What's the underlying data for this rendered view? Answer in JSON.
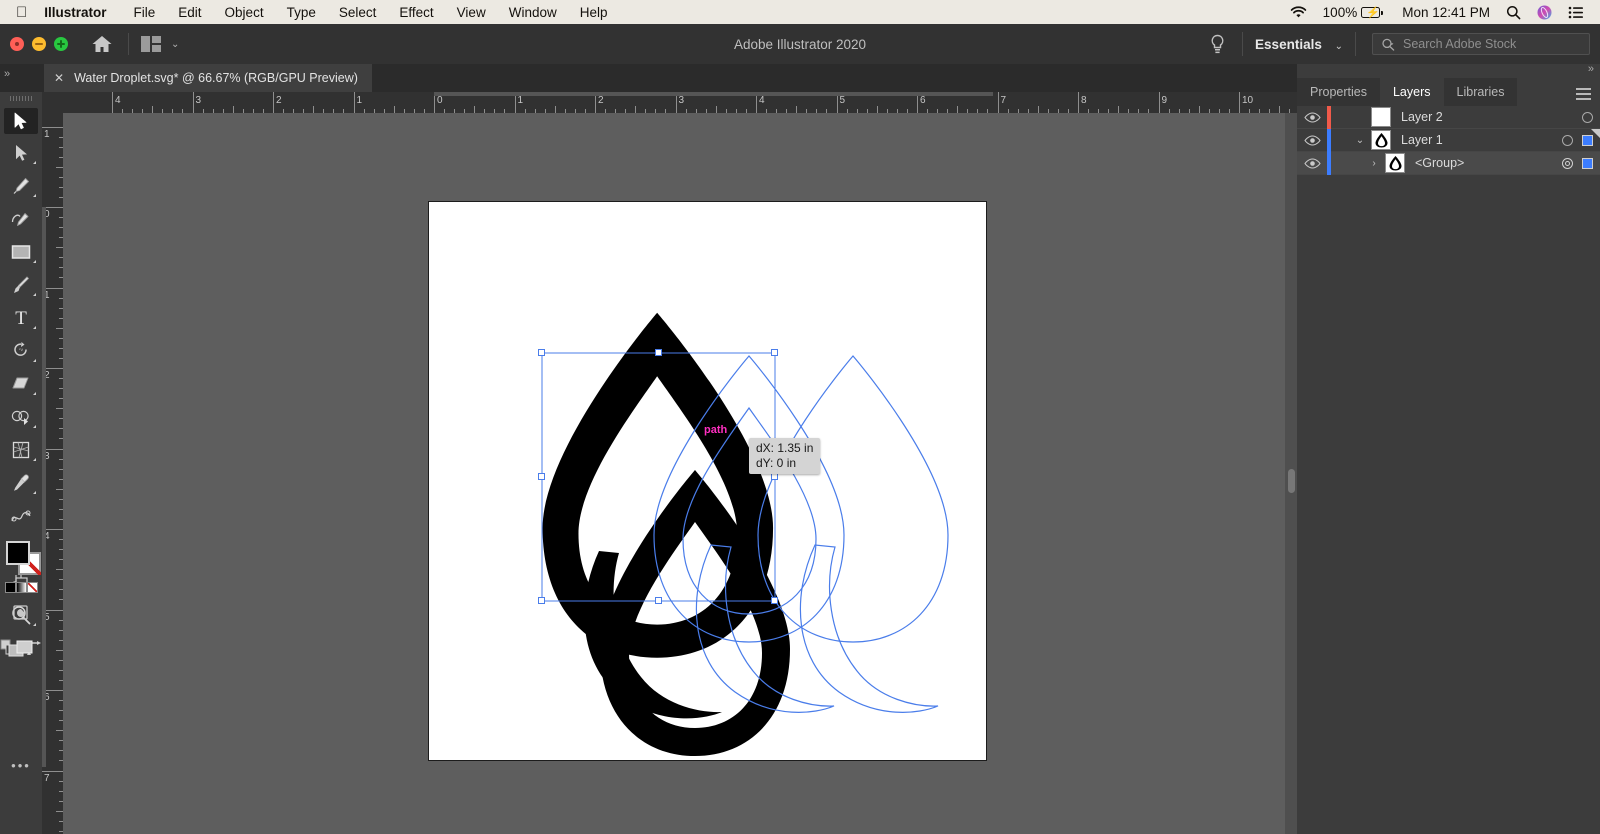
{
  "macmenu": {
    "apple_icon": "apple-logo-icon",
    "items": [
      "Illustrator",
      "File",
      "Edit",
      "Object",
      "Type",
      "Select",
      "Effect",
      "View",
      "Window",
      "Help"
    ],
    "status": {
      "wifi_icon": "wifi-icon",
      "battery_percent": "100%",
      "battery_icon": "battery-charging-icon",
      "clock": "Mon 12:41 PM",
      "spotlight_icon": "search-icon",
      "siri_icon": "siri-icon",
      "controlcenter_icon": "control-center-icon"
    }
  },
  "titlebar": {
    "app_title": "Adobe Illustrator 2020",
    "home_icon": "home-icon",
    "arrange_icon": "arrange-documents-icon",
    "arrange_chevron": "⌄",
    "bulb_icon": "lightbulb-icon",
    "workspace": "Essentials",
    "workspace_chevron": "⌄",
    "search_icon": "search-icon",
    "search_placeholder": "Search Adobe Stock",
    "search_value": ""
  },
  "tabbar": {
    "collapse_arrows": "»",
    "close_icon": "close-icon",
    "document_tab": "Water Droplet.svg* @ 66.67% (RGB/GPU Preview)"
  },
  "toolbar": {
    "grip_icon": "panel-grip-icon",
    "tools": [
      {
        "name": "selection-tool",
        "active": true,
        "flyout": false
      },
      {
        "name": "direct-selection-tool",
        "active": false,
        "flyout": true
      },
      {
        "name": "pen-tool",
        "active": false,
        "flyout": true
      },
      {
        "name": "curvature-tool",
        "active": false,
        "flyout": false
      },
      {
        "name": "rectangle-tool",
        "active": false,
        "flyout": true
      },
      {
        "name": "paintbrush-tool",
        "active": false,
        "flyout": true
      },
      {
        "name": "type-tool",
        "active": false,
        "flyout": true
      },
      {
        "name": "rotate-tool",
        "active": false,
        "flyout": true
      },
      {
        "name": "eraser-tool",
        "active": false,
        "flyout": true
      },
      {
        "name": "shape-builder-tool",
        "active": false,
        "flyout": true
      },
      {
        "name": "gradient-mesh-tool",
        "active": false,
        "flyout": true
      },
      {
        "name": "eyedropper-tool",
        "active": false,
        "flyout": true
      },
      {
        "name": "blend-tool",
        "active": false,
        "flyout": false
      },
      {
        "name": "symbol-sprayer-tool",
        "active": false,
        "flyout": true
      },
      {
        "name": "artboard-tool",
        "active": false,
        "flyout": false
      },
      {
        "name": "zoom-tool",
        "active": false,
        "flyout": true
      }
    ],
    "swap_fill_stroke_icon": "swap-fill-stroke-icon",
    "default_fill_stroke_icon": "default-fill-stroke-icon",
    "fill_color": "#000000",
    "stroke_color": "#ffffff",
    "stroke_none": true,
    "color_mini": "color-swatch-icon",
    "gradient_mini": "gradient-swatch-icon",
    "none_mini": "none-swatch-icon",
    "drawing_mode_icon": "draw-normal-icon",
    "screen_mode_icon": "change-screen-mode-icon",
    "more_tools": "•••"
  },
  "rulers": {
    "unit": "in",
    "h_labels": [
      "4",
      "3",
      "2",
      "1",
      "0",
      "1",
      "2",
      "3",
      "4",
      "5",
      "6",
      "7",
      "8",
      "9",
      "10"
    ],
    "v_labels": [
      "1",
      "0",
      "1",
      "2",
      "3",
      "4",
      "5",
      "6",
      "7"
    ]
  },
  "canvas": {
    "artboard_fill": "#ffffff",
    "canvas_fill": "#5e5e5e",
    "selection_color": "#4a7dea",
    "artwork_fill": "#000000",
    "smart_guide_label": "path",
    "smart_guide_color": "#ff2fc1",
    "tooltip": {
      "dx": "dX: 1.35 in",
      "dy": "dY: 0 in"
    },
    "scrollbar_icon": "vertical-scrollbar"
  },
  "rightpanel": {
    "collapse_arrows": "»",
    "expand_chevron": "⌃",
    "menu_icon": "panel-menu-icon",
    "tabs": [
      {
        "label": "Properties",
        "selected": false
      },
      {
        "label": "Layers",
        "selected": true
      },
      {
        "label": "Libraries",
        "selected": false
      }
    ],
    "layers": [
      {
        "name": "Layer 2",
        "visibility_icon": "eye-icon",
        "color": "#f05a4a",
        "thumb_icon": "blank-layer-thumbnail",
        "disclosure": "",
        "indent": 0,
        "selected": false,
        "target_icon": "target-circle-icon",
        "has_selection_square": false
      },
      {
        "name": "Layer 1",
        "visibility_icon": "eye-icon",
        "color": "#3c7dff",
        "thumb_icon": "droplet-layer-thumbnail",
        "disclosure": "⌄",
        "indent": 0,
        "selected": false,
        "target_icon": "target-circle-icon",
        "has_selection_square": true
      },
      {
        "name": "<Group>",
        "visibility_icon": "eye-icon",
        "color": "#3c7dff",
        "thumb_icon": "droplet-group-thumbnail",
        "disclosure": "›",
        "indent": 1,
        "selected": true,
        "target_icon": "target-circle-selected-icon",
        "has_selection_square": true
      }
    ]
  }
}
